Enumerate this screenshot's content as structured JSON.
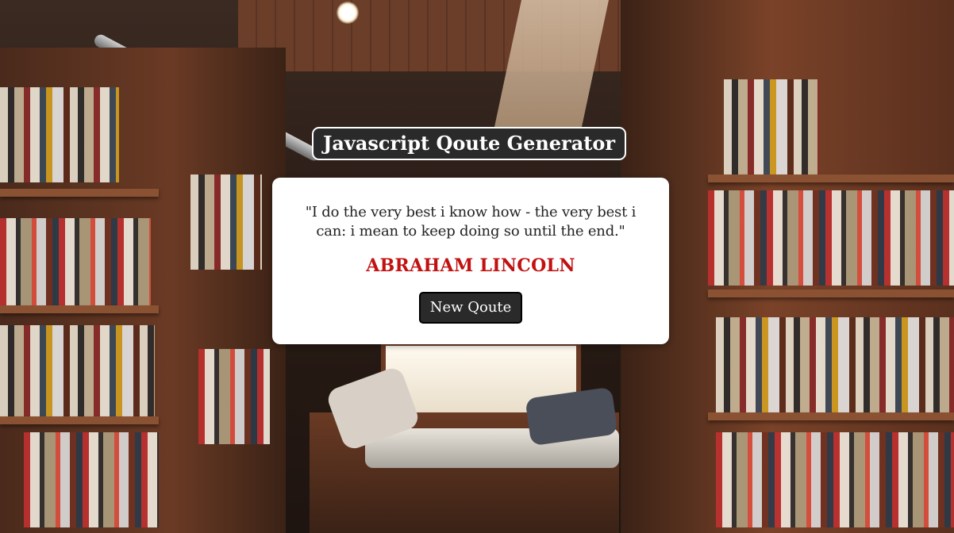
{
  "app": {
    "title": "Javascript Qoute Generator"
  },
  "quote": {
    "text": "\"I do the very best i know how - the very best i can: i mean to keep doing so until the end.\"",
    "author": "ABRAHAM LINCOLN"
  },
  "actions": {
    "new_quote_label": "New Qoute"
  },
  "colors": {
    "title_bg": "#2b2a2a",
    "author_text": "#c11111",
    "card_bg": "#ffffff",
    "button_bg": "#2b2a2a"
  },
  "background": {
    "icon": "bookstore-background-image"
  }
}
